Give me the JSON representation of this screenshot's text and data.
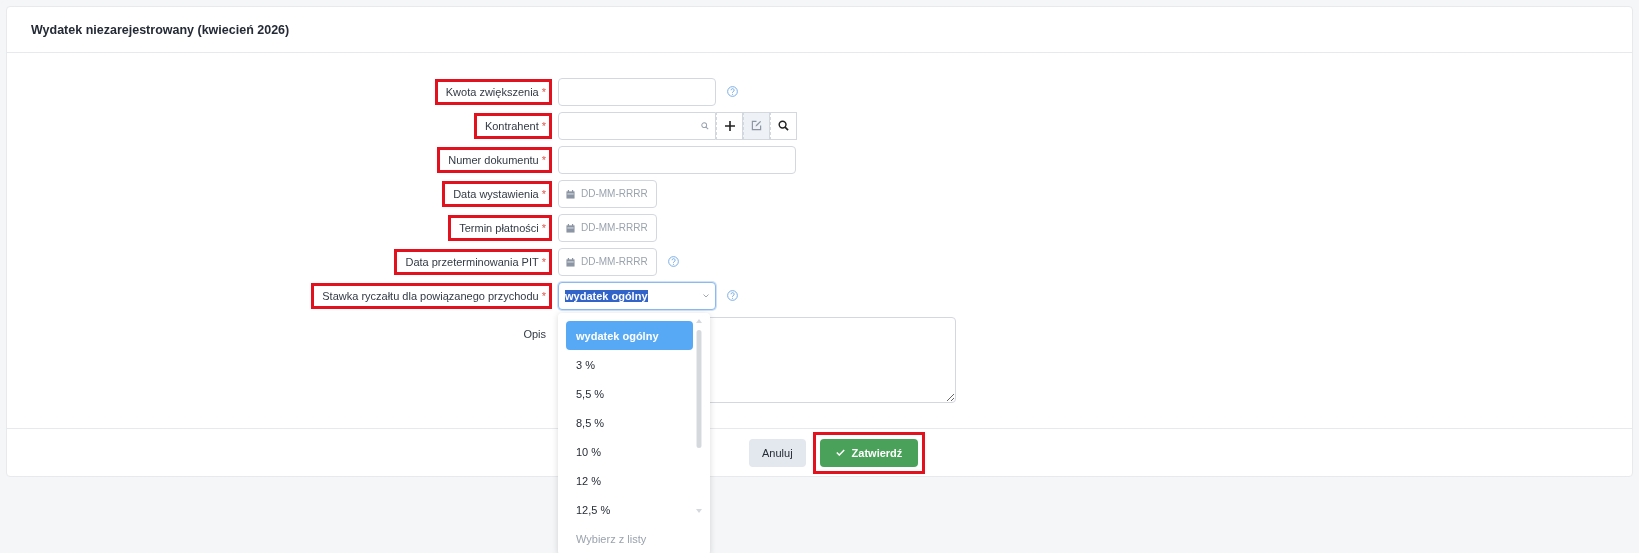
{
  "title": "Wydatek niezarejestrowany (kwiecień 2026)",
  "fields": [
    {
      "kind": "text",
      "label": "Kwota zwiększenia",
      "required_mark": "*",
      "highlighted": true,
      "help": true
    },
    {
      "kind": "lookup",
      "label": "Kontrahent",
      "required_mark": "*",
      "highlighted": true,
      "help": false
    },
    {
      "kind": "wide",
      "label": "Numer dokumentu",
      "required_mark": "*",
      "highlighted": true,
      "help": false
    },
    {
      "kind": "date",
      "label": "Data wystawienia",
      "required_mark": "*",
      "highlighted": true,
      "help": false,
      "placeholder": "DD-MM-RRRR"
    },
    {
      "kind": "date",
      "label": "Termin płatności",
      "required_mark": "*",
      "highlighted": true,
      "help": false,
      "placeholder": "DD-MM-RRRR"
    },
    {
      "kind": "date",
      "label": "Data przeterminowania PIT",
      "required_mark": "*",
      "highlighted": true,
      "help": true,
      "placeholder": "DD-MM-RRRR"
    },
    {
      "kind": "select",
      "label": "Stawka ryczałtu dla powiązanego przychodu",
      "required_mark": "*",
      "highlighted": true,
      "help": true,
      "value": "wydatek ogólny",
      "open": true,
      "options": [
        {
          "label": "wydatek ogólny",
          "selected": true,
          "disabled": false
        },
        {
          "label": "3 %",
          "selected": false,
          "disabled": false
        },
        {
          "label": "5,5 %",
          "selected": false,
          "disabled": false
        },
        {
          "label": "8,5 %",
          "selected": false,
          "disabled": false
        },
        {
          "label": "10 %",
          "selected": false,
          "disabled": false
        },
        {
          "label": "12 %",
          "selected": false,
          "disabled": false
        },
        {
          "label": "12,5 %",
          "selected": false,
          "disabled": false
        },
        {
          "label": "Wybierz z listy",
          "selected": false,
          "disabled": true
        }
      ]
    },
    {
      "kind": "textarea",
      "label": "Opis",
      "highlighted": false,
      "help": false
    }
  ],
  "buttons": [
    {
      "kind": "secondary",
      "label": "Anuluj",
      "highlighted": false
    },
    {
      "kind": "primary",
      "label": "Zatwierdź",
      "highlighted": true
    }
  ]
}
